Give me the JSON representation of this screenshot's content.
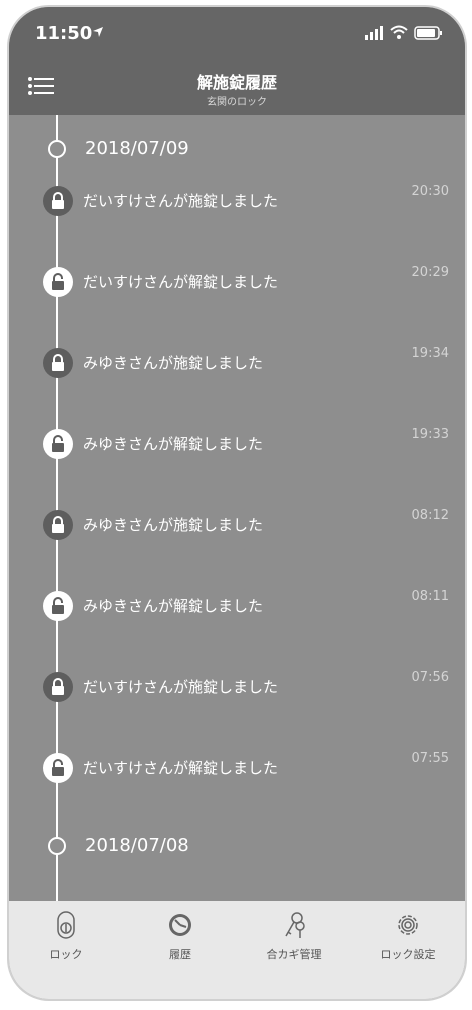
{
  "status": {
    "time": "11:50"
  },
  "header": {
    "title": "解施錠履歴",
    "subtitle": "玄関のロック"
  },
  "timeline": {
    "date1": "2018/07/09",
    "date2": "2018/07/08",
    "events": [
      {
        "text": "だいすけさんが施錠しました",
        "time": "20:30",
        "state": "locked"
      },
      {
        "text": "だいすけさんが解錠しました",
        "time": "20:29",
        "state": "unlocked"
      },
      {
        "text": "みゆきさんが施錠しました",
        "time": "19:34",
        "state": "locked"
      },
      {
        "text": "みゆきさんが解錠しました",
        "time": "19:33",
        "state": "unlocked"
      },
      {
        "text": "みゆきさんが施錠しました",
        "time": "08:12",
        "state": "locked"
      },
      {
        "text": "みゆきさんが解錠しました",
        "time": "08:11",
        "state": "unlocked"
      },
      {
        "text": "だいすけさんが施錠しました",
        "time": "07:56",
        "state": "locked"
      },
      {
        "text": "だいすけさんが解錠しました",
        "time": "07:55",
        "state": "unlocked"
      }
    ]
  },
  "tabs": [
    {
      "label": "ロック",
      "icon": "lock-device-icon"
    },
    {
      "label": "履歴",
      "icon": "history-clock-icon"
    },
    {
      "label": "合カギ管理",
      "icon": "keys-icon"
    },
    {
      "label": "ロック設定",
      "icon": "gear-icon"
    }
  ]
}
